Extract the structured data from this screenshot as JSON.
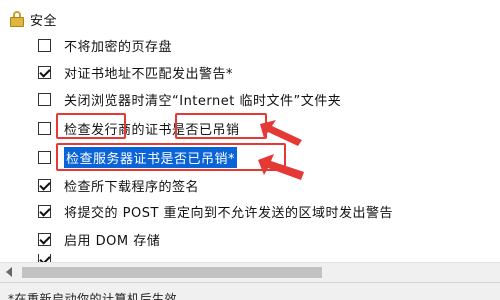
{
  "section": {
    "title": "安全",
    "icon": "lock-icon"
  },
  "options": [
    {
      "label": "不将加密的页存盘",
      "checked": false
    },
    {
      "label": "对证书地址不匹配发出警告*",
      "checked": true
    },
    {
      "label": "关闭浏览器时清空“Internet 临时文件”文件夹",
      "checked": false
    },
    {
      "label": "检查发行商的证书是否已吊销",
      "checked": false
    },
    {
      "label": "检查服务器证书是否已吊销*",
      "checked": false,
      "selected": true
    },
    {
      "label": "检查所下载程序的签名",
      "checked": true
    },
    {
      "label": "将提交的 POST 重定向到不允许发送的区域时发出警告",
      "checked": true
    },
    {
      "label": "启用 DOM 存储",
      "checked": true
    }
  ],
  "footnote": "*在重新启动你的计算机后生效",
  "colors": {
    "highlight": "#0a64d8",
    "annotation": "#e53935"
  }
}
